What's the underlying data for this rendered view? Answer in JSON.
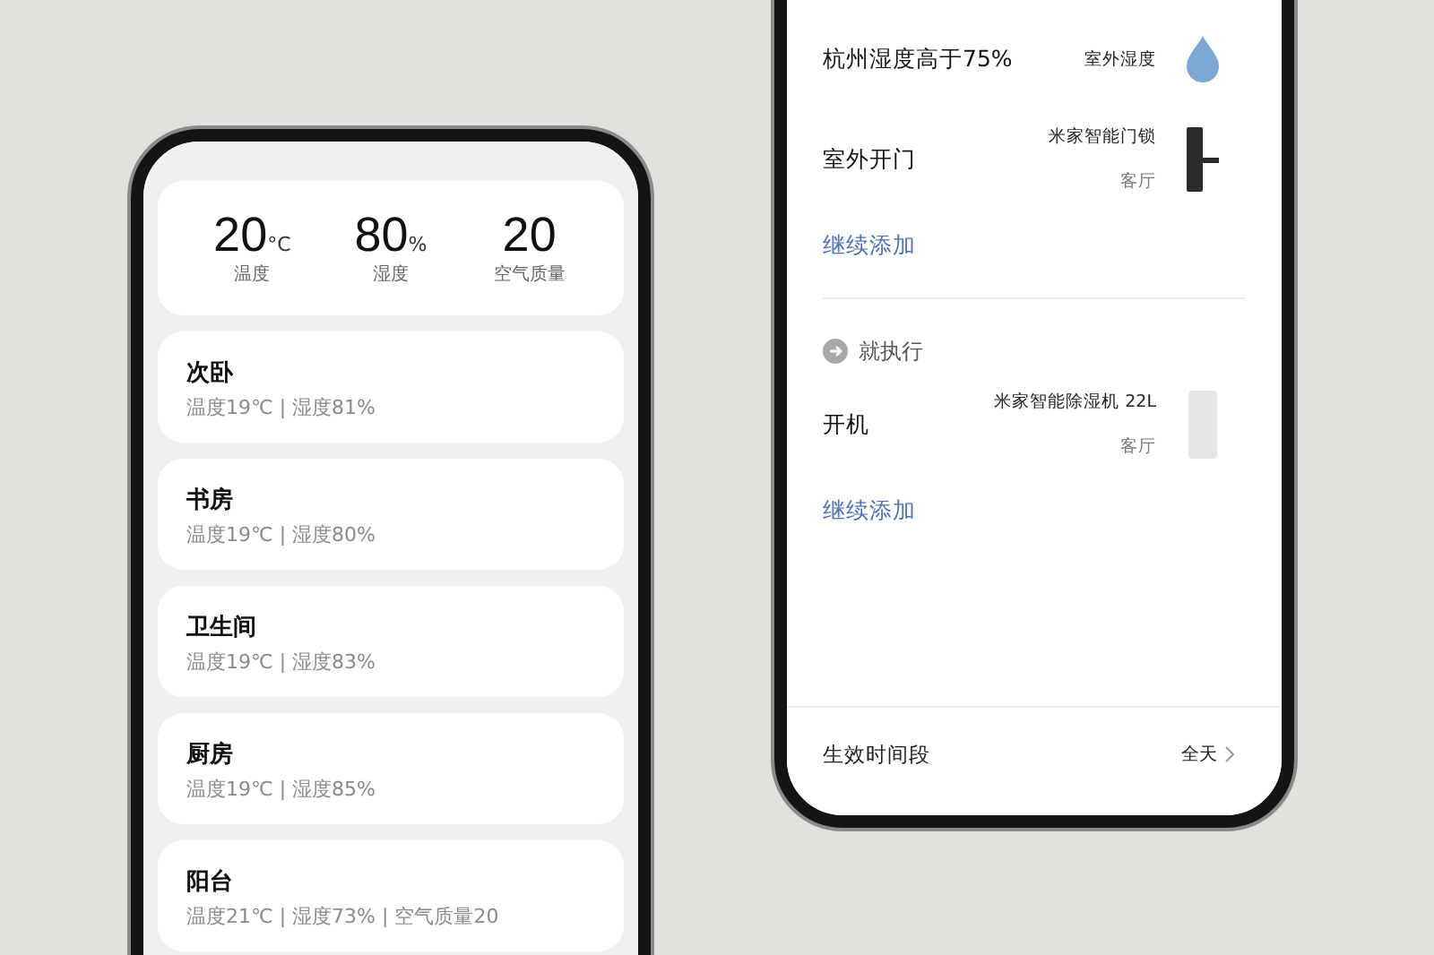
{
  "left_phone": {
    "summary": [
      {
        "value": "20",
        "unit": "°C",
        "label": "温度"
      },
      {
        "value": "80",
        "unit": "%",
        "label": "湿度"
      },
      {
        "value": "20",
        "label": "空气质量"
      }
    ],
    "rooms": [
      {
        "name": "次卧",
        "details": "温度19℃ | 湿度81%"
      },
      {
        "name": "书房",
        "details": "温度19℃ | 湿度80%"
      },
      {
        "name": "卫生间",
        "details": "温度19℃ | 湿度83%"
      },
      {
        "name": "厨房",
        "details": "温度19℃ | 湿度85%"
      },
      {
        "name": "阳台",
        "details": "温度21℃ | 湿度73% | 空气质量20"
      }
    ]
  },
  "right_phone": {
    "conditions": [
      {
        "kind": "humidity",
        "title": "杭州湿度高于75%",
        "device": "室外湿度"
      },
      {
        "kind": "lock",
        "title": "室外开门",
        "device": "米家智能门锁",
        "room": "客厅"
      }
    ],
    "add_condition": "继续添加",
    "actions_header": "就执行",
    "actions": [
      {
        "kind": "dehumidifier",
        "title": "开机",
        "device": "米家智能除湿机 22L",
        "room": "客厅"
      }
    ],
    "add_action": "继续添加",
    "time_period": {
      "label": "生效时间段",
      "value": "全天"
    }
  }
}
